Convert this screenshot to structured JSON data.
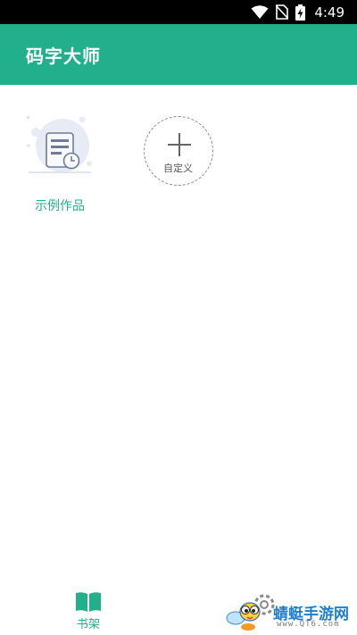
{
  "status_bar": {
    "time": "4:49",
    "icons": [
      "wifi-icon",
      "no-sim-icon",
      "battery-charging-icon"
    ]
  },
  "header": {
    "title": "码字大师"
  },
  "shelf": {
    "items": [
      {
        "label": "示例作品",
        "icon": "document-clock-icon"
      }
    ],
    "custom_button": {
      "label": "自定义",
      "icon": "plus-icon"
    }
  },
  "bottom_nav": {
    "tabs": [
      {
        "label": "书架",
        "icon": "open-book-icon",
        "active": true
      }
    ]
  },
  "watermark": {
    "brand": "蜻蜓手游网",
    "url": "www.QT6.com"
  },
  "colors": {
    "accent": "#22b08c",
    "status_bar": "#000000",
    "watermark_text": "#1e7fd0"
  }
}
